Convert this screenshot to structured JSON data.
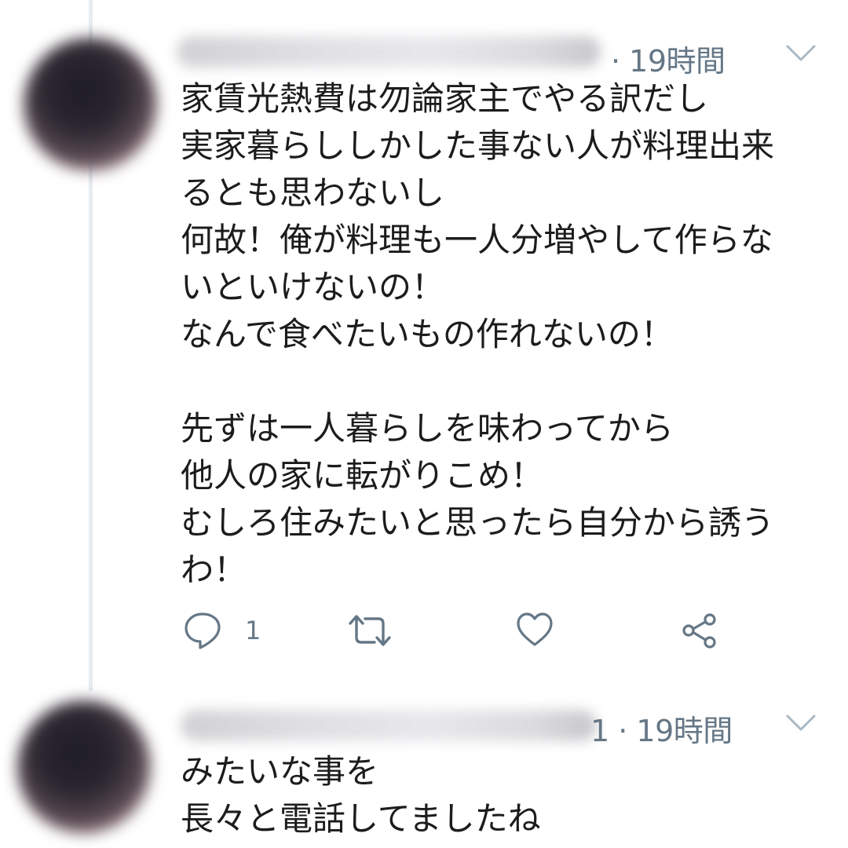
{
  "tweets": [
    {
      "time": "· 19時間",
      "text": "家賃光熱費は勿論家主でやる訳だし\n実家暮らししかした事ない人が料理出来\nるとも思わないし\n何故！俺が料理も一人分増やして作らな\nいといけないの！\nなんで食べたいもの作れないの！\n\n先ずは一人暮らしを味わってから\n他人の家に転がりこめ！\nむしろ住みたいと思ったら自分から誘う\nわ！",
      "reply_count": "1",
      "icons": [
        "reply-icon",
        "retweet-icon",
        "like-icon",
        "share-icon",
        "chevron-down-icon"
      ]
    },
    {
      "time": "1 · 19時間",
      "text": "みたいな事を\n長々と電話してましたね",
      "icons": [
        "chevron-down-icon"
      ]
    }
  ],
  "colors": {
    "text": "#1c1c1c",
    "secondary": "#657786",
    "thread_line": "#e6ecf0",
    "background": "#ffffff"
  }
}
